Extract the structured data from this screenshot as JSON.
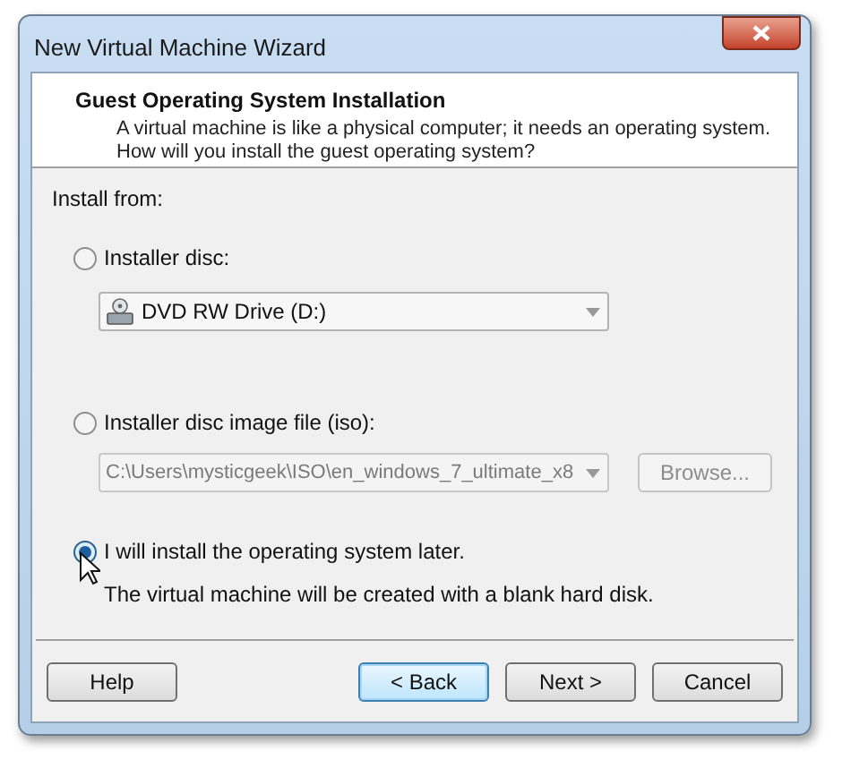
{
  "window": {
    "title": "New Virtual Machine Wizard"
  },
  "header": {
    "title": "Guest Operating System Installation",
    "description": "A virtual machine is like a physical computer; it needs an operating system. How will you install the guest operating system?"
  },
  "install_from": "Install from:",
  "options": [
    {
      "kind": "disc",
      "label": "Installer disc:",
      "selected": false,
      "dropdown": {
        "value": "DVD RW Drive (D:)",
        "disabled": false
      }
    },
    {
      "kind": "iso",
      "label": "Installer disc image file (iso):",
      "selected": false,
      "dropdown": {
        "value": "C:\\Users\\mysticgeek\\ISO\\en_windows_7_ultimate_x8",
        "disabled": true
      },
      "browse": {
        "label": "Browse...",
        "disabled": true
      }
    },
    {
      "kind": "later",
      "label": "I will install the operating system later.",
      "selected": true,
      "note": "The virtual machine will be created with a blank hard disk."
    }
  ],
  "buttons": [
    {
      "label": "Help",
      "focused": false
    },
    {
      "label": "< Back",
      "focused": true
    },
    {
      "label": "Next >",
      "focused": false
    },
    {
      "label": "Cancel",
      "focused": false
    }
  ]
}
